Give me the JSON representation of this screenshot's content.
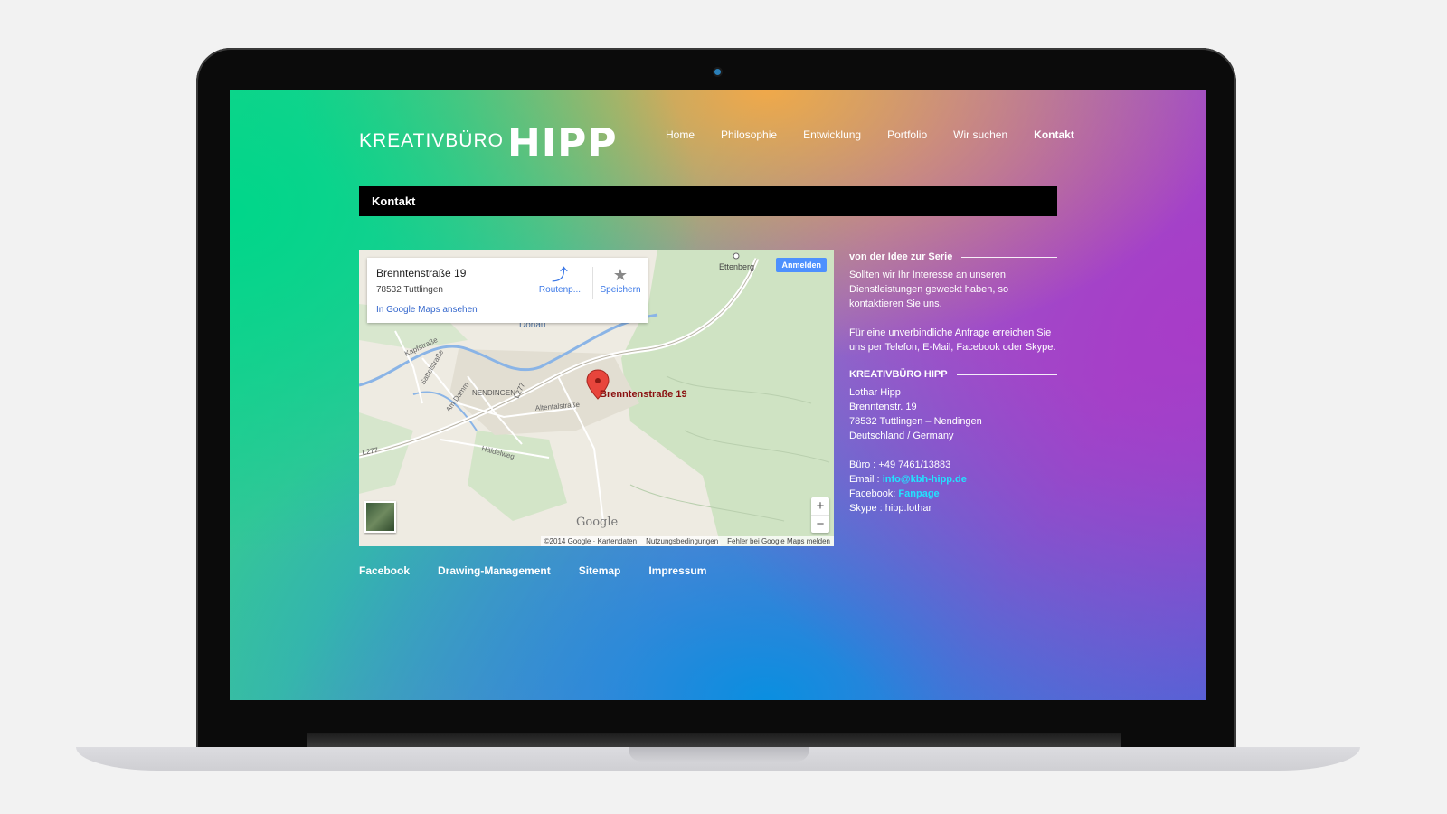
{
  "site": {
    "logo_small": "KREATIVBÜRO",
    "logo_big": "HIPP"
  },
  "nav": {
    "items": [
      "Home",
      "Philosophie",
      "Entwicklung",
      "Portfolio",
      "Wir suchen",
      "Kontakt"
    ],
    "active": "Kontakt"
  },
  "page_title": "Kontakt",
  "map": {
    "card_title": "Brenntenstraße 19",
    "card_subtitle": "78532 Tuttlingen",
    "card_link": "In Google Maps ansehen",
    "route_label": "Routenp...",
    "save_label": "Speichern",
    "signin_label": "Anmelden",
    "marker_label": "Brenntenstraße 19",
    "place_labels": [
      "Ettenberg",
      "Donau",
      "Kapfstraße",
      "Sattelstraße",
      "Am Damm",
      "NENDINGEN",
      "L277",
      "Altentalstraße",
      "Häldelweg",
      "L277"
    ],
    "watermark": "Google",
    "footer": [
      "©2014 Google · Kartendaten",
      "Nutzungsbedingungen",
      "Fehler bei Google Maps melden"
    ],
    "zoom_in": "+",
    "zoom_out": "−"
  },
  "sidebar": {
    "heading1": "von der Idee zur Serie",
    "para1": "Sollten wir Ihr Interesse an unseren Dienstleistungen geweckt haben, so kontaktieren Sie uns.",
    "para2": "Für eine unverbindliche Anfrage erreichen Sie uns per Telefon, E-Mail, Facebook oder Skype.",
    "heading2": "KREATIVBÜRO HIPP",
    "address": [
      "Lothar Hipp",
      "Brenntenstr. 19",
      "78532 Tuttlingen – Nendingen",
      "Deutschland / Germany"
    ],
    "phone_label": "Büro : +49 7461/13883",
    "email_label": "Email : ",
    "email": "info@kbh-hipp.de",
    "facebook_label": "Facebook: ",
    "facebook": "Fanpage",
    "skype": "Skype : hipp.lothar"
  },
  "footer": {
    "links": [
      "Facebook",
      "Drawing-Management",
      "Sitemap",
      "Impressum"
    ]
  }
}
